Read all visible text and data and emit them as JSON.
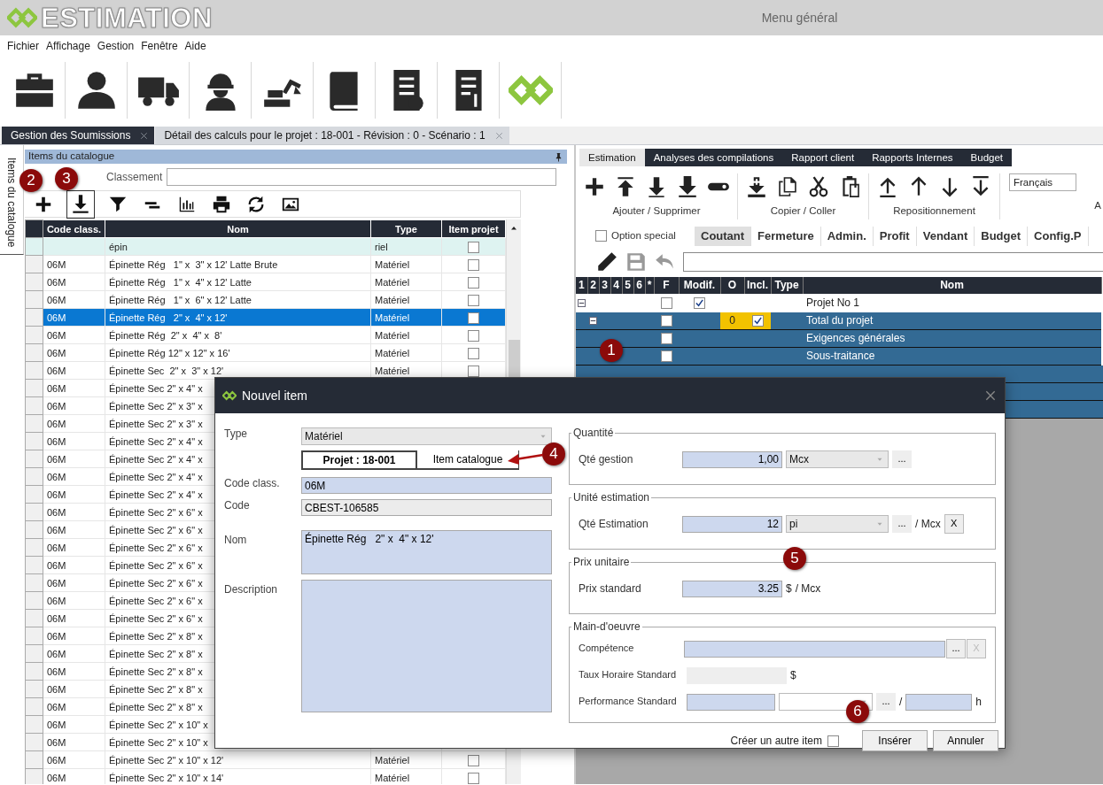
{
  "app": {
    "logo_text": "ESTIMATION",
    "title": "Menu général"
  },
  "menu": [
    "Fichier",
    "Affichage",
    "Gestion",
    "Fenêtre",
    "Aide"
  ],
  "toolbar": [
    {
      "kind": "briefcase"
    },
    {
      "kind": "person"
    },
    {
      "kind": "truck"
    },
    {
      "kind": "worker"
    },
    {
      "kind": "excavator"
    },
    {
      "kind": "book"
    },
    {
      "kind": "doc-check"
    },
    {
      "kind": "doc-dollar"
    },
    {
      "kind": "logo"
    }
  ],
  "doc_tabs": [
    {
      "label": "Gestion des Soumissions",
      "selected": false
    },
    {
      "label": "Détail des calculs pour le projet : 18-001 - Révision : 0 - Scénario : 1",
      "selected": true
    }
  ],
  "side_tab": {
    "label": "Items du catalogue"
  },
  "catalog": {
    "title": "Items du catalogue",
    "filter_label": "Classement",
    "tools": [
      {
        "kind": "add",
        "selected": false
      },
      {
        "kind": "import",
        "selected": true
      },
      {
        "kind": "funnel",
        "selected": false
      },
      {
        "kind": "collapse",
        "selected": false
      },
      {
        "kind": "chart",
        "selected": false
      },
      {
        "kind": "print",
        "selected": false
      },
      {
        "kind": "refresh",
        "selected": false
      },
      {
        "kind": "image",
        "selected": false
      }
    ],
    "columns": [
      "Code class.",
      "Nom",
      "Type",
      "Item projet"
    ],
    "filter_row": {
      "nom": "épin",
      "type": "riel",
      "item_projet": false
    },
    "rows": [
      {
        "code": "06M",
        "nom": "Épinette Rég   1\" x  3\" x 12' Latte Brute",
        "type": "Matériel",
        "item_projet": false,
        "selected": false
      },
      {
        "code": "06M",
        "nom": "Épinette Rég   1\" x  4\" x 12' Latte",
        "type": "Matériel",
        "item_projet": false,
        "selected": false
      },
      {
        "code": "06M",
        "nom": "Épinette Rég   1\" x  6\" x 12' Latte",
        "type": "Matériel",
        "item_projet": false,
        "selected": false
      },
      {
        "code": "06M",
        "nom": "Épinette Rég   2\" x  4\" x 12'",
        "type": "Matériel",
        "item_projet": false,
        "selected": true
      },
      {
        "code": "06M",
        "nom": "Épinette Rég  2\" x  4\" x  8'",
        "type": "Matériel",
        "item_projet": false,
        "selected": false
      },
      {
        "code": "06M",
        "nom": "Épinette Rég 12\" x 12\" x 16'",
        "type": "Matériel",
        "item_projet": false,
        "selected": false
      },
      {
        "code": "06M",
        "nom": "Épinette Sec  2\" x  3\" x 12'",
        "type": "Matériel",
        "item_projet": false,
        "selected": false
      },
      {
        "code": "06M",
        "nom": "Épinette Sec 2\" x 4\" x",
        "selected": false
      },
      {
        "code": "06M",
        "nom": "Épinette Sec 2\" x 3\" x",
        "selected": false
      },
      {
        "code": "06M",
        "nom": "Épinette Sec 2\" x 3\" x",
        "selected": false
      },
      {
        "code": "06M",
        "nom": "Épinette Sec 2\" x 4\" x",
        "selected": false
      },
      {
        "code": "06M",
        "nom": "Épinette Sec 2\" x 4\" x",
        "selected": false
      },
      {
        "code": "06M",
        "nom": "Épinette Sec 2\" x 4\" x",
        "selected": false
      },
      {
        "code": "06M",
        "nom": "Épinette Sec 2\" x 4\" x",
        "selected": false
      },
      {
        "code": "06M",
        "nom": "Épinette Sec 2\" x 6\" x",
        "selected": false
      },
      {
        "code": "06M",
        "nom": "Épinette Sec 2\" x 6\" x",
        "selected": false
      },
      {
        "code": "06M",
        "nom": "Épinette Sec 2\" x 6\" x",
        "selected": false
      },
      {
        "code": "06M",
        "nom": "Épinette Sec 2\" x 6\" x",
        "selected": false
      },
      {
        "code": "06M",
        "nom": "Épinette Sec 2\" x 6\" x",
        "selected": false
      },
      {
        "code": "06M",
        "nom": "Épinette Sec 2\" x 6\" x",
        "selected": false
      },
      {
        "code": "06M",
        "nom": "Épinette Sec 2\" x 6\" x",
        "selected": false
      },
      {
        "code": "06M",
        "nom": "Épinette Sec 2\" x 8\" x",
        "selected": false
      },
      {
        "code": "06M",
        "nom": "Épinette Sec 2\" x 8\" x",
        "selected": false
      },
      {
        "code": "06M",
        "nom": "Épinette Sec 2\" x 8\" x",
        "selected": false
      },
      {
        "code": "06M",
        "nom": "Épinette Sec 2\" x 8\" x",
        "selected": false
      },
      {
        "code": "06M",
        "nom": "Épinette Sec 2\" x 8\" x",
        "selected": false
      },
      {
        "code": "06M",
        "nom": "Épinette Sec 2\" x 10\" x",
        "selected": false
      },
      {
        "code": "06M",
        "nom": "Épinette Sec 2\" x 10\" x",
        "selected": false
      },
      {
        "code": "06M",
        "nom": "Épinette Sec 2\" x 10\" x 12'",
        "type": "Matériel",
        "item_projet": false,
        "selected": false
      },
      {
        "code": "06M",
        "nom": "Épinette Sec 2\" x 10\" x 14'",
        "type": "Matériel",
        "item_projet": false,
        "selected": false
      }
    ]
  },
  "estimation": {
    "tabs": [
      {
        "label": "Estimation",
        "selected": true
      },
      {
        "label": "Analyses des compilations",
        "selected": false
      },
      {
        "label": "Rapport client",
        "selected": false
      },
      {
        "label": "Rapports Internes",
        "selected": false
      },
      {
        "label": "Budget",
        "selected": false
      }
    ],
    "ribbon": {
      "groups": [
        {
          "label": "Ajouter / Supprimer",
          "tools": [
            {
              "kind": "add"
            },
            {
              "kind": "insert-above"
            },
            {
              "kind": "insert-below"
            },
            {
              "kind": "insert-last"
            },
            {
              "kind": "toggle"
            }
          ]
        },
        {
          "label": "Copier / Coller",
          "tools": [
            {
              "kind": "insert"
            },
            {
              "kind": "copy"
            },
            {
              "kind": "cut"
            },
            {
              "kind": "paste"
            }
          ]
        },
        {
          "label": "Repositionnement",
          "tools": [
            {
              "kind": "move-top"
            },
            {
              "kind": "move-up"
            },
            {
              "kind": "move-down"
            },
            {
              "kind": "move-bottom"
            }
          ]
        }
      ],
      "language": "Français",
      "next_group_label": "A"
    },
    "option_special": {
      "label": "Option special",
      "checked": false
    },
    "views": [
      {
        "label": "Coutant",
        "selected": true
      },
      {
        "label": "Fermeture",
        "selected": false
      },
      {
        "label": "Admin.",
        "selected": false
      },
      {
        "label": "Profit",
        "selected": false
      },
      {
        "label": "Vendant",
        "selected": false
      },
      {
        "label": "Budget",
        "selected": false
      },
      {
        "label": "Config.P",
        "selected": false
      }
    ],
    "edit_tools": [
      {
        "kind": "pencil"
      },
      {
        "kind": "save"
      },
      {
        "kind": "undo"
      }
    ],
    "tree": {
      "columns": [
        "1",
        "2",
        "3",
        "4",
        "5",
        "6",
        "*",
        "F",
        "Modif.",
        "O",
        "Incl.",
        "Type",
        "Nom"
      ],
      "rows": [
        {
          "nom": "Projet No 1",
          "f": false,
          "modif": true,
          "selected": false,
          "expanded": true,
          "children": [
            {
              "nom": "Total du projet",
              "f": false,
              "o": "0",
              "incl": true,
              "selected": true,
              "expanded": true,
              "children": [
                {
                  "nom": "Exigences générales",
                  "f": false,
                  "selected": true
                },
                {
                  "nom": "Sous-traitance",
                  "f": false,
                  "selected": true
                }
              ]
            }
          ]
        }
      ]
    }
  },
  "dialog": {
    "title": "Nouvel item",
    "type": {
      "label": "Type",
      "value": "Matériel"
    },
    "source_toggle": [
      {
        "label": "Projet : 18-001",
        "selected": true
      },
      {
        "label": "Item catalogue",
        "selected": false
      }
    ],
    "fields": [
      {
        "label": "Code class.",
        "value": "06M",
        "readonly": false
      },
      {
        "label": "Code",
        "value": "CBEST-106585",
        "readonly": true
      }
    ],
    "nom": {
      "label": "Nom",
      "value": "Épinette Rég   2\" x  4\" x 12'"
    },
    "description": {
      "label": "Description"
    },
    "quantite": {
      "legend": "Quantité",
      "label": "Qté gestion",
      "value": "1,00",
      "unit": "Mcx",
      "more": "..."
    },
    "unite": {
      "legend": "Unité estimation",
      "label": "Qté Estimation",
      "value": "12",
      "unit": "pi",
      "more": "...",
      "per": "/ Mcx",
      "clear": "X",
      "disabled": false
    },
    "prix": {
      "legend": "Prix unitaire",
      "label": "Prix standard",
      "value": "3.25",
      "currency": "$",
      "per": "/ Mcx"
    },
    "main_oeuvre": {
      "legend": "Main-d'oeuvre",
      "competence": {
        "label": "Compétence",
        "more": "...",
        "clear": "X",
        "disabled": true
      },
      "taux": {
        "label": "Taux Horaire Standard",
        "currency": "$"
      },
      "performance": {
        "label": "Performance Standard",
        "more": "...",
        "sep": "/",
        "unit": "h"
      }
    },
    "create_another": {
      "label": "Créer un autre item",
      "checked": false
    },
    "buttons": [
      "Insérer",
      "Annuler"
    ]
  },
  "annotations": [
    {
      "label": "1"
    },
    {
      "label": "2"
    },
    {
      "label": "3"
    },
    {
      "label": "4"
    },
    {
      "label": "5"
    },
    {
      "label": "6"
    }
  ]
}
